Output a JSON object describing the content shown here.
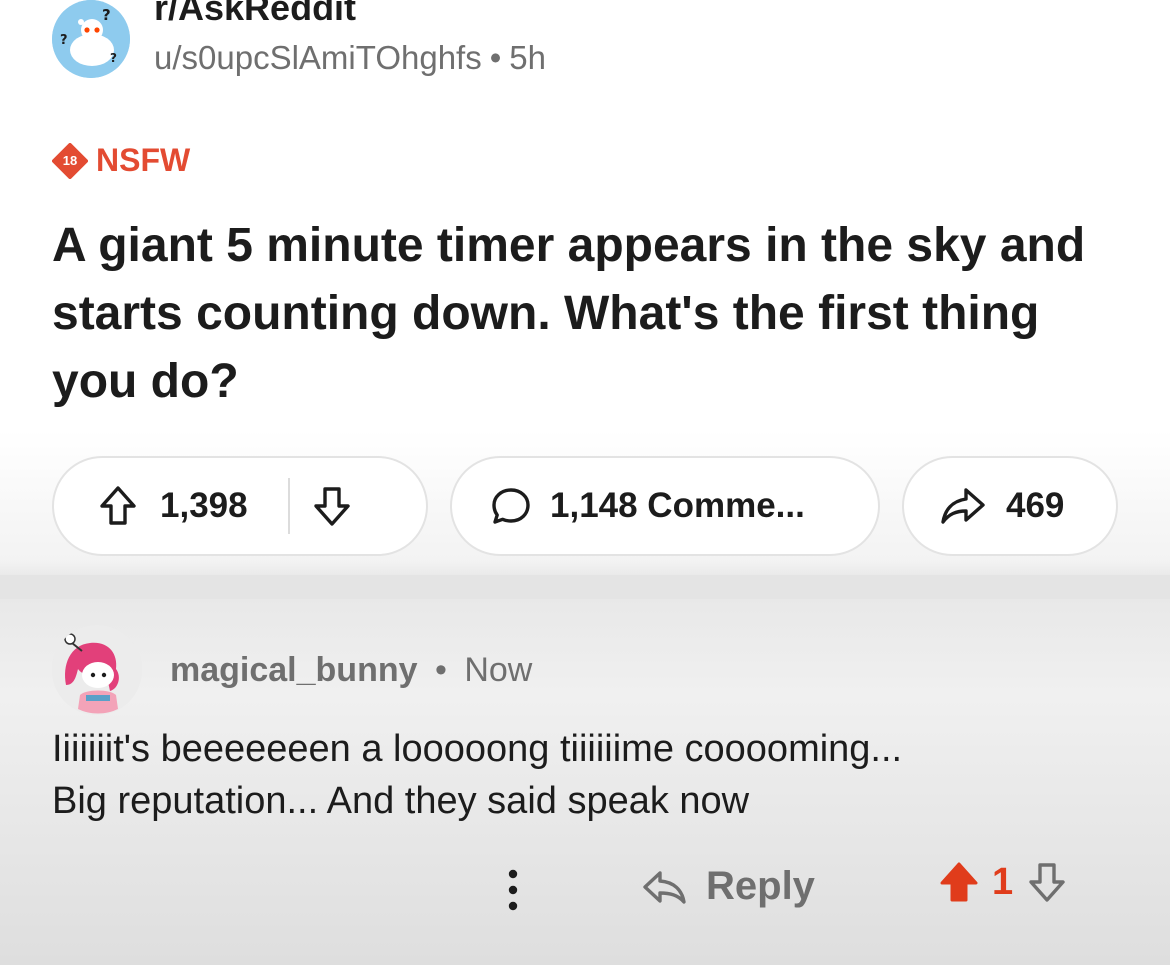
{
  "post": {
    "subreddit": "r/AskReddit",
    "author": "u/s0upcSlAmiTOhghfs",
    "separator": "•",
    "age": "5h",
    "nsfw_badge_number": "18",
    "nsfw_label": "NSFW",
    "title": "A giant 5 minute timer appears in the sky and starts counting down. What's the first thing you do?",
    "upvotes": "1,398",
    "comments": "1,148 Comme...",
    "shares": "469",
    "icons": {
      "subreddit_avatar": "reddit-snoo-question-icon",
      "upvote": "arrow-up-outline-icon",
      "downvote": "arrow-down-outline-icon",
      "comment": "speech-bubble-icon",
      "share": "share-arrow-icon"
    }
  },
  "comment": {
    "author": "magical_bunny",
    "separator": "•",
    "age": "Now",
    "lines": [
      "Iiiiiiit's beeeeeeen a looooong tiiiiiime cooooming...",
      "Big reputation... And they said speak now"
    ],
    "reply_label": "Reply",
    "score": "1",
    "icons": {
      "avatar": "pink-haired-snoo-avatar-icon",
      "more": "vertical-ellipsis-icon",
      "reply": "reply-arrow-icon",
      "upvote": "arrow-up-filled-icon",
      "downvote": "arrow-down-outline-icon"
    },
    "colors": {
      "upvoted": "#e03c1b"
    }
  },
  "colors": {
    "nsfw": "#e34b32",
    "meta_text": "#6f6f6f",
    "primary_text": "#1c1c1c"
  }
}
